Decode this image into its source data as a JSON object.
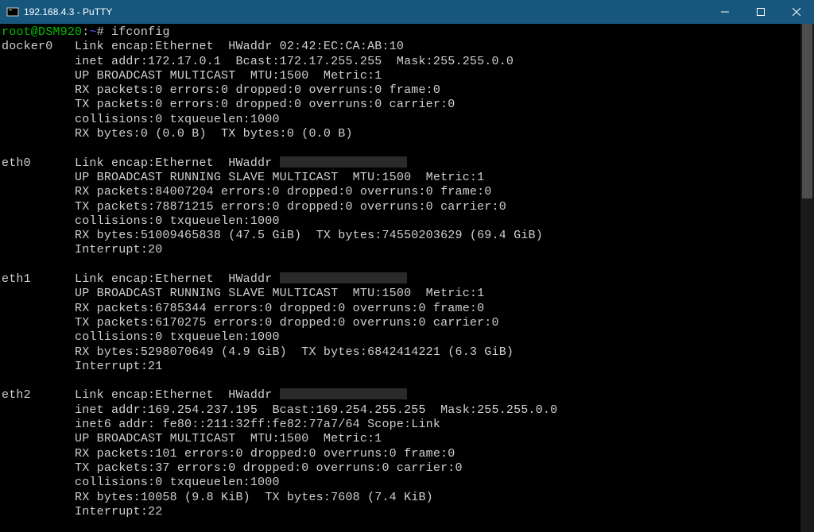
{
  "window": {
    "title": "192.168.4.3 - PuTTY"
  },
  "prompt": {
    "user_host": "root@DSM920",
    "path": ":~# ",
    "command": "ifconfig"
  },
  "interfaces": [
    {
      "name": "docker0",
      "lines": [
        "Link encap:Ethernet  HWaddr 02:42:EC:CA:AB:10",
        "inet addr:172.17.0.1  Bcast:172.17.255.255  Mask:255.255.0.0",
        "UP BROADCAST MULTICAST  MTU:1500  Metric:1",
        "RX packets:0 errors:0 dropped:0 overruns:0 frame:0",
        "TX packets:0 errors:0 dropped:0 overruns:0 carrier:0",
        "collisions:0 txqueuelen:1000",
        "RX bytes:0 (0.0 B)  TX bytes:0 (0.0 B)"
      ],
      "redactedFirst": false
    },
    {
      "name": "eth0",
      "lines": [
        "Link encap:Ethernet  HWaddr ",
        "UP BROADCAST RUNNING SLAVE MULTICAST  MTU:1500  Metric:1",
        "RX packets:84007204 errors:0 dropped:0 overruns:0 frame:0",
        "TX packets:78871215 errors:0 dropped:0 overruns:0 carrier:0",
        "collisions:0 txqueuelen:1000",
        "RX bytes:51009465838 (47.5 GiB)  TX bytes:74550203629 (69.4 GiB)",
        "Interrupt:20"
      ],
      "redactedFirst": true
    },
    {
      "name": "eth1",
      "lines": [
        "Link encap:Ethernet  HWaddr ",
        "UP BROADCAST RUNNING SLAVE MULTICAST  MTU:1500  Metric:1",
        "RX packets:6785344 errors:0 dropped:0 overruns:0 frame:0",
        "TX packets:6170275 errors:0 dropped:0 overruns:0 carrier:0",
        "collisions:0 txqueuelen:1000",
        "RX bytes:5298070649 (4.9 GiB)  TX bytes:6842414221 (6.3 GiB)",
        "Interrupt:21"
      ],
      "redactedFirst": true
    },
    {
      "name": "eth2",
      "lines": [
        "Link encap:Ethernet  HWaddr ",
        "inet addr:169.254.237.195  Bcast:169.254.255.255  Mask:255.255.0.0",
        "inet6 addr: fe80::211:32ff:fe82:77a7/64 Scope:Link",
        "UP BROADCAST MULTICAST  MTU:1500  Metric:1",
        "RX packets:101 errors:0 dropped:0 overruns:0 frame:0",
        "TX packets:37 errors:0 dropped:0 overruns:0 carrier:0",
        "collisions:0 txqueuelen:1000",
        "RX bytes:10058 (9.8 KiB)  TX bytes:7608 (7.4 KiB)",
        "Interrupt:22"
      ],
      "redactedFirst": true
    }
  ],
  "layout": {
    "namePad": 10,
    "indentPad": 10
  }
}
